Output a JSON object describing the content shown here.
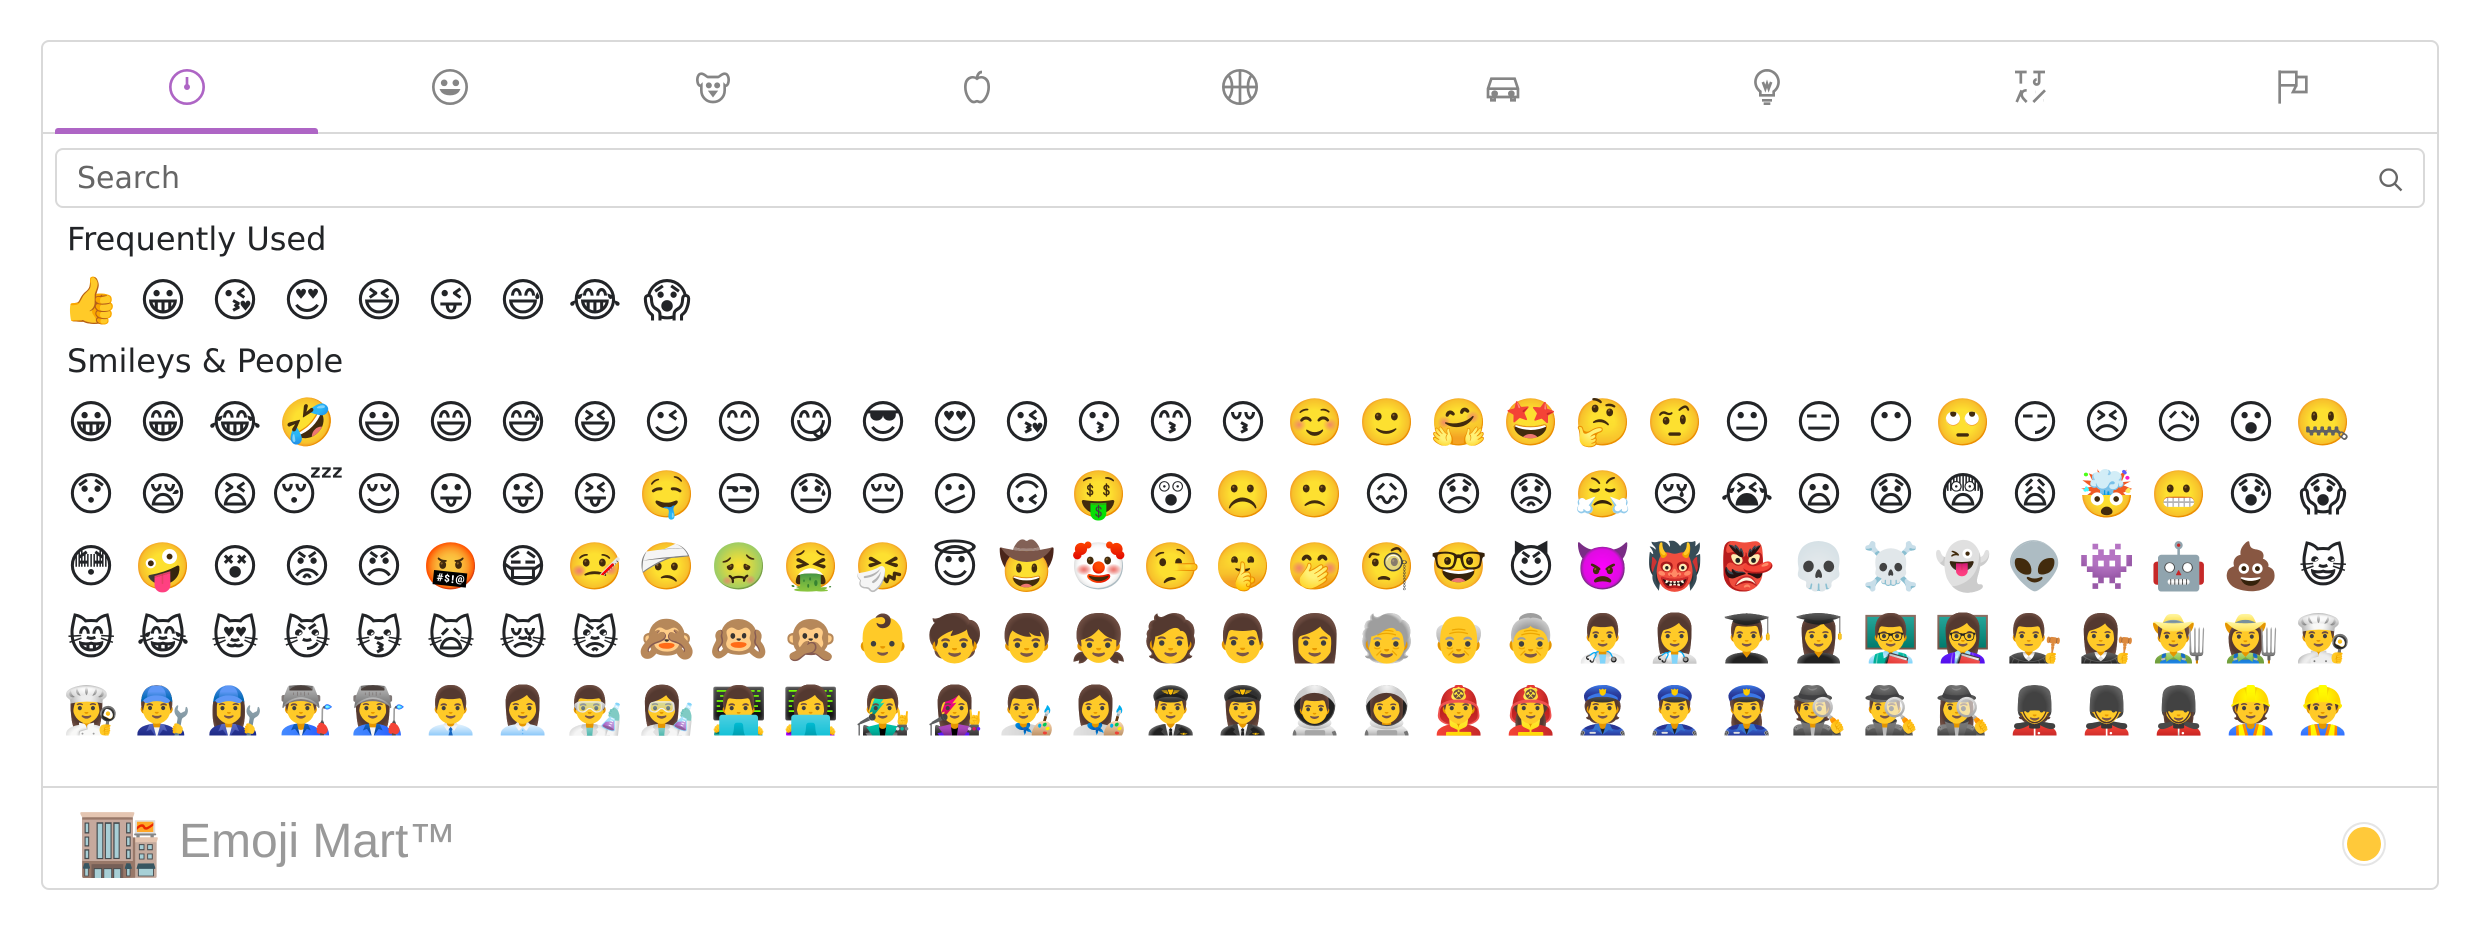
{
  "search": {
    "placeholder": "Search"
  },
  "categories": {
    "frequent": {
      "title": "Frequently Used",
      "emojis": [
        "👍",
        "😀",
        "😘",
        "😍",
        "😆",
        "😜",
        "😅",
        "😂",
        "😱"
      ]
    },
    "people": {
      "title": "Smileys & People",
      "rows": [
        [
          "😀",
          "😁",
          "😂",
          "🤣",
          "😃",
          "😄",
          "😅",
          "😆",
          "😉",
          "😊",
          "😋",
          "😎",
          "😍",
          "😘",
          "😗",
          "😙",
          "😚",
          "☺️",
          "🙂",
          "🤗",
          "🤩",
          "🤔",
          "🤨",
          "😐",
          "😑",
          "😶",
          "🙄",
          "😏",
          "😣",
          "😥",
          "😮",
          "🤐"
        ],
        [
          "😯",
          "😪",
          "😫",
          "😴",
          "😌",
          "😛",
          "😜",
          "😝",
          "🤤",
          "😒",
          "😓",
          "😔",
          "😕",
          "🙃",
          "🤑",
          "😲",
          "☹️",
          "🙁",
          "😖",
          "😞",
          "😟",
          "😤",
          "😢",
          "😭",
          "😦",
          "😧",
          "😨",
          "😩",
          "🤯",
          "😬",
          "😰",
          "😱"
        ],
        [
          "😳",
          "🤪",
          "😵",
          "😡",
          "😠",
          "🤬",
          "😷",
          "🤒",
          "🤕",
          "🤢",
          "🤮",
          "🤧",
          "😇",
          "🤠",
          "🤡",
          "🤥",
          "🤫",
          "🤭",
          "🧐",
          "🤓",
          "😈",
          "👿",
          "👹",
          "👺",
          "💀",
          "☠️",
          "👻",
          "👽",
          "👾",
          "🤖",
          "💩",
          "😺"
        ],
        [
          "😸",
          "😹",
          "😻",
          "😼",
          "😽",
          "🙀",
          "😿",
          "😾",
          "🙈",
          "🙉",
          "🙊",
          "👶",
          "🧒",
          "👦",
          "👧",
          "🧑",
          "👨",
          "👩",
          "🧓",
          "👴",
          "👵",
          "👨‍⚕️",
          "👩‍⚕️",
          "👨‍🎓",
          "👩‍🎓",
          "👨‍🏫",
          "👩‍🏫",
          "👨‍⚖️",
          "👩‍⚖️",
          "👨‍🌾",
          "👩‍🌾",
          "👨‍🍳"
        ],
        [
          "👩‍🍳",
          "👨‍🔧",
          "👩‍🔧",
          "👨‍🏭",
          "👩‍🏭",
          "👨‍💼",
          "👩‍💼",
          "👨‍🔬",
          "👩‍🔬",
          "👨‍💻",
          "👩‍💻",
          "👨‍🎤",
          "👩‍🎤",
          "👨‍🎨",
          "👩‍🎨",
          "👨‍✈️",
          "👩‍✈️",
          "👨‍🚀",
          "👩‍🚀",
          "👨‍🚒",
          "👩‍🚒",
          "👮",
          "👮‍♂️",
          "👮‍♀️",
          "🕵️",
          "🕵️‍♂️",
          "🕵️‍♀️",
          "💂",
          "💂‍♂️",
          "💂‍♀️",
          "👷",
          "👷‍♂️"
        ]
      ]
    }
  },
  "preview": {
    "logo": "🏬",
    "title": "Emoji Mart™"
  },
  "colors": {
    "accent": "#ae65c5",
    "skin_tone": "#ffc93a"
  },
  "anchors": [
    "clock-icon",
    "smiley-icon",
    "dog-icon",
    "apple-icon",
    "basketball-icon",
    "car-icon",
    "lightbulb-icon",
    "symbols-icon",
    "flags-icon"
  ]
}
